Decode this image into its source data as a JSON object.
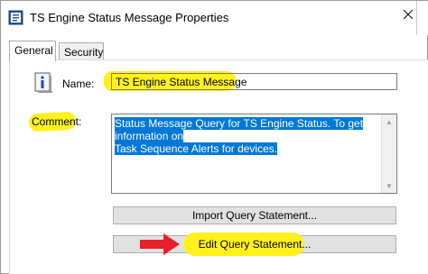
{
  "window": {
    "title": "TS Engine Status Message Properties",
    "close_icon": "close-icon"
  },
  "tabs": [
    {
      "label": "General",
      "active": true
    },
    {
      "label": "Security",
      "active": false
    }
  ],
  "general": {
    "name_label": "Name:",
    "name_value": "TS Engine Status Message",
    "comment_label": "Comment:",
    "comment_value": "Status Message Query for TS Engine Status. To get information on Task Sequence Alerts for devices.",
    "comment_line1": "Status Message Query for TS Engine Status. To get information on",
    "comment_line2": "Task Sequence Alerts for devices.",
    "import_button": "Import Query Statement...",
    "edit_button": "Edit Query Statement..."
  },
  "annotations": {
    "highlight_color": "#fff21c",
    "arrow_color": "#e8202a",
    "selection_color": "#0078d7"
  }
}
